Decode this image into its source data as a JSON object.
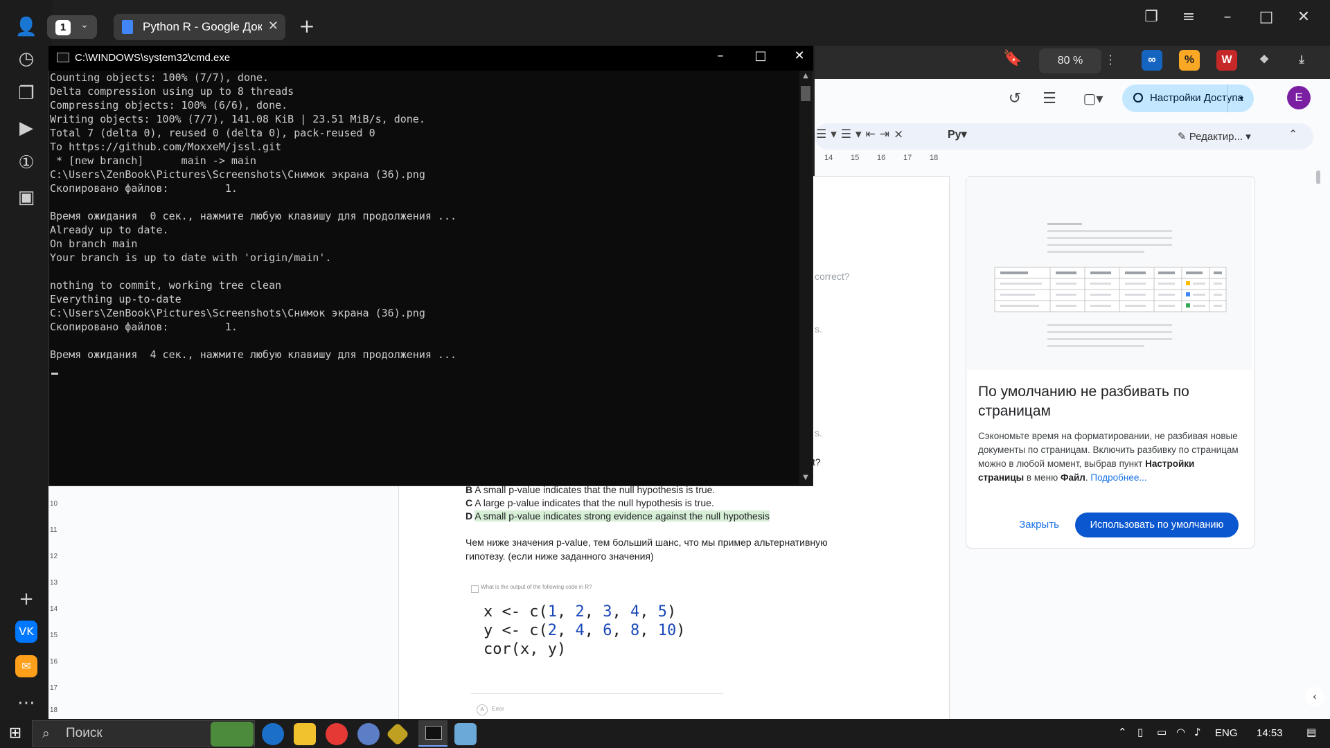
{
  "browser": {
    "tab_count": "1",
    "active_tab_title": "Python R - Google Доку",
    "zoom": "80 %",
    "extensions": [
      "∞",
      "%",
      "W"
    ]
  },
  "docs": {
    "share_label": "Настройки Доступа",
    "avatar_letter": "E",
    "edit_mode": "Редактир...",
    "ruler_marks": [
      "14",
      "15",
      "16",
      "17",
      "18"
    ],
    "style_label": "Pу",
    "body": {
      "frag_correct": "correct?",
      "frag_s1": "s.",
      "frag_s2": "s.",
      "frag_ct": "ct?",
      "opt_b": "A small p-value indicates that the null hypothesis is true.",
      "opt_b_letter": "B",
      "opt_c": "A large p-value indicates that the null hypothesis is true.",
      "opt_c_letter": "C",
      "opt_d": "A small p-value indicates strong evidence against the null hypothesis",
      "opt_d_letter": "D",
      "note_line1": "Чем ниже значения p-value, тем больший шанс, что мы пример альтернативную",
      "note_line2": "гипотезу. (если ниже заданного значения)",
      "question_small": "What is the output of the following code in R?",
      "code_line1_pre": "x <- c(",
      "code_line2_pre": "y <- c(",
      "code_line3": "cor(x, y)",
      "code_x": [
        "1",
        "2",
        "3",
        "4",
        "5"
      ],
      "code_y": [
        "2",
        "4",
        "6",
        "8",
        "10"
      ],
      "answer_a_letter": "A",
      "answer_a": "Error"
    },
    "card": {
      "title": "По умолчанию не разбивать по страницам",
      "text_part1": "Сэкономьте время на форматировании, не разбивая новые документы по страницам. Включить разбивку по страницам можно в любой момент, выбрав пункт ",
      "text_bold1": "Настройки страницы",
      "text_part2": " в меню ",
      "text_bold2": "Файл",
      "text_part3": ". ",
      "more_link": "Подробнее...",
      "close_label": "Закрыть",
      "use_label": "Использовать по умолчанию"
    },
    "left_ruler": [
      "10",
      "11",
      "12",
      "13",
      "14",
      "15",
      "16",
      "17",
      "18"
    ]
  },
  "cmd": {
    "title": "C:\\WINDOWS\\system32\\cmd.exe",
    "lines": [
      "Counting objects: 100% (7/7), done.",
      "Delta compression using up to 8 threads",
      "Compressing objects: 100% (6/6), done.",
      "Writing objects: 100% (7/7), 141.08 KiB | 23.51 MiB/s, done.",
      "Total 7 (delta 0), reused 0 (delta 0), pack-reused 0",
      "To https://github.com/MoxxeM/jssl.git",
      " * [new branch]      main -> main",
      "C:\\Users\\ZenBook\\Pictures\\Screenshots\\Снимок экрана (36).png",
      "Скопировано файлов:         1.",
      "",
      "Время ожидания  0 сек., нажмите любую клавишу для продолжения ...",
      "Already up to date.",
      "On branch main",
      "Your branch is up to date with 'origin/main'.",
      "",
      "nothing to commit, working tree clean",
      "Everything up-to-date",
      "C:\\Users\\ZenBook\\Pictures\\Screenshots\\Снимок экрана (36).png",
      "Скопировано файлов:         1.",
      "",
      "Время ожидания  4 сек., нажмите любую клавишу для продолжения ..."
    ]
  },
  "taskbar": {
    "search_placeholder": "Поиск",
    "language": "ENG",
    "time": "14:53"
  },
  "colors": {
    "docs_highlight": "#d6efd6",
    "share_bg": "#c2e7ff",
    "primary_button": "#0b57d0"
  }
}
